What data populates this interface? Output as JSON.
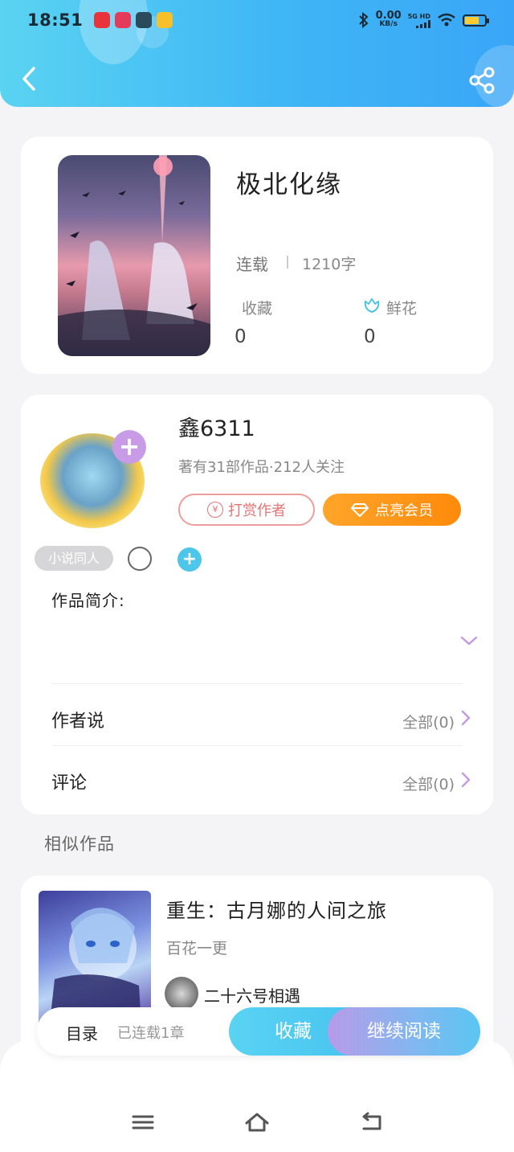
{
  "status_bar": {
    "time": "18:51",
    "net_speed_value": "0.00",
    "net_speed_unit": "KB/s",
    "network_type": "5G HD",
    "app_icons": [
      "netease-music-icon",
      "shopping-app-icon",
      "dark-app-icon",
      "weibo-icon"
    ],
    "battery_color": "#ffcb2f"
  },
  "header": {
    "back_icon": "chevron-left-icon",
    "share_icon": "share-icon",
    "gradient": [
      "#5ad3f2",
      "#3aa6f7"
    ]
  },
  "book": {
    "title": "极北化缘",
    "status": "连载",
    "word_count": "1210字",
    "favorites_label": "收藏",
    "favorites_count": "0",
    "flowers_label": "鲜花",
    "flowers_count": "0"
  },
  "author": {
    "name": "鑫6311",
    "meta": "著有31部作品·212人关注",
    "reward_label": "打赏作者",
    "vip_label": "点亮会员",
    "tag": "小说同人",
    "avatar_plus": "+",
    "tag_plus": "+"
  },
  "sections": {
    "intro_label": "作品简介:",
    "author_says_label": "作者说",
    "author_says_count": "全部(0)",
    "comments_label": "评论",
    "comments_count": "全部(0)"
  },
  "similar": {
    "heading": "相似作品",
    "items": [
      {
        "title": "重生：古月娜的人间之旅",
        "desc": "百花一更",
        "author": "二十六号相遇"
      }
    ]
  },
  "action_bar": {
    "toc_label": "目录",
    "chapters_label": "已连载1章",
    "collect_label": "收藏",
    "read_label": "继续阅读"
  },
  "nav": {
    "icons": [
      "menu-icon",
      "home-icon",
      "back-icon"
    ]
  }
}
